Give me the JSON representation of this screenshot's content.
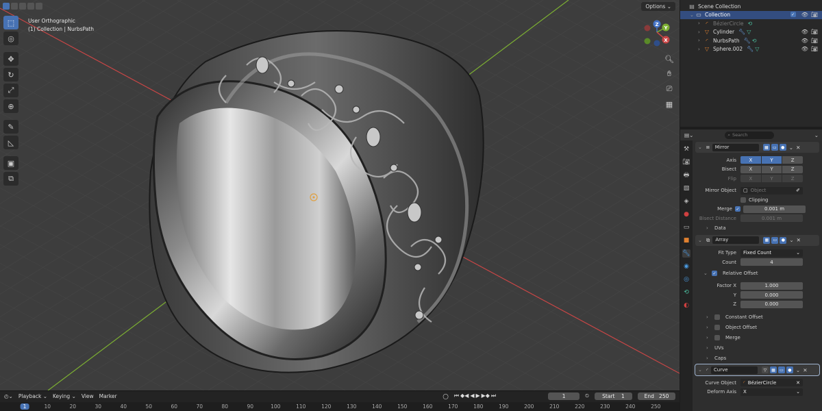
{
  "viewport": {
    "view_name": "User Orthographic",
    "context": "(1) Collection | NurbsPath",
    "options_label": "Options",
    "gizmo": {
      "x": "X",
      "y": "Y",
      "z": "Z"
    },
    "tools": [
      "select-box-icon",
      "cursor-icon",
      "move-icon",
      "rotate-icon",
      "scale-icon",
      "transform-icon",
      "annotate-icon",
      "measure-icon",
      "add-cube-icon",
      "extrude-icon"
    ],
    "nav_tools": [
      "zoom-icon",
      "pan-hand-icon",
      "camera-icon",
      "grid-icon"
    ],
    "colors": {
      "background": "#3d3d3d",
      "x_axis": "#c84646",
      "y_axis": "#7cb032",
      "accent": "#4772b3"
    }
  },
  "timeline": {
    "playback_label": "Playback",
    "keying_label": "Keying",
    "view_label": "View",
    "marker_label": "Marker",
    "current_frame": "1",
    "start_label": "Start",
    "start_value": "1",
    "end_label": "End",
    "end_value": "250",
    "ruler_ticks": [
      "1",
      "10",
      "20",
      "30",
      "40",
      "50",
      "60",
      "70",
      "80",
      "90",
      "100",
      "110",
      "120",
      "130",
      "140",
      "150",
      "160",
      "170",
      "180",
      "190",
      "200",
      "210",
      "220",
      "230",
      "240",
      "250"
    ]
  },
  "outliner": {
    "scene_collection": "Scene Collection",
    "collection": "Collection",
    "objects": [
      {
        "name": "BézierCircle",
        "icon": "curve-icon",
        "dim": true
      },
      {
        "name": "Cylinder",
        "icon": "mesh-icon",
        "dim": false
      },
      {
        "name": "NurbsPath",
        "icon": "curve-icon",
        "dim": false
      },
      {
        "name": "Sphere.002",
        "icon": "mesh-icon",
        "dim": false
      }
    ]
  },
  "properties": {
    "search_placeholder": "Search",
    "mirror": {
      "name": "Mirror",
      "axis_label": "Axis",
      "bisect_label": "Bisect",
      "flip_label": "Flip",
      "axes": [
        "X",
        "Y",
        "Z"
      ],
      "mirror_object_label": "Mirror Object",
      "mirror_object_placeholder": "Object",
      "clipping_label": "Clipping",
      "merge_label": "Merge",
      "merge_value": "0.001 m",
      "bisect_distance_label": "Bisect Distance",
      "bisect_distance_value": "0.001 m",
      "data_label": "Data"
    },
    "array": {
      "name": "Array",
      "fit_type_label": "Fit Type",
      "fit_type_value": "Fixed Count",
      "count_label": "Count",
      "count_value": "4",
      "relative_offset_label": "Relative Offset",
      "factor_x_label": "Factor X",
      "factor_x_value": "1.000",
      "y_label": "Y",
      "y_value": "0.000",
      "z_label": "Z",
      "z_value": "0.000",
      "constant_offset_label": "Constant Offset",
      "object_offset_label": "Object Offset",
      "merge_label": "Merge",
      "uvs_label": "UVs",
      "caps_label": "Caps"
    },
    "curve": {
      "name": "Curve",
      "curve_object_label": "Curve Object",
      "curve_object_value": "BézierCircle",
      "deform_axis_label": "Deform Axis",
      "deform_axis_value": "X"
    }
  }
}
